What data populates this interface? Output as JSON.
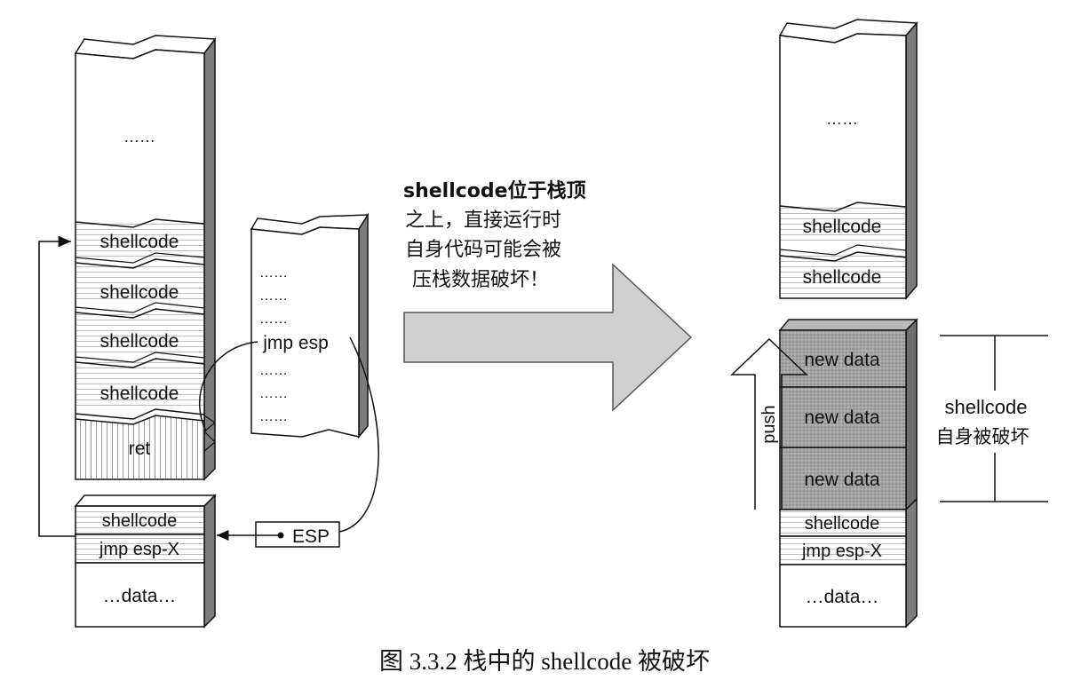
{
  "left_stack": {
    "top_dots": "……",
    "shellcode_blocks": [
      "shellcode",
      "shellcode",
      "shellcode",
      "shellcode"
    ],
    "ret_label": "ret",
    "lower_shellcode": "shellcode",
    "lower_jmp": "jmp esp-X",
    "lower_data": "…data…"
  },
  "code_panel": {
    "dots_1": "……",
    "dots_2": "……",
    "dots_3": "……",
    "jmp_label": "jmp esp",
    "dots_4": "……",
    "dots_5": "……",
    "dots_6": "……"
  },
  "esp_label": "ESP",
  "annotation": {
    "line1": "shellcode位于栈顶",
    "line2": "之上，直接运行时",
    "line3": "自身代码可能会被",
    "line4": "压栈数据破坏！"
  },
  "right_stack": {
    "top_dots": "……",
    "shellcode_blocks": [
      "shellcode",
      "shellcode"
    ],
    "new_data": [
      "new data",
      "new data",
      "new data"
    ],
    "push_label": "push",
    "lower_shellcode": "shellcode",
    "lower_jmp": "jmp esp-X",
    "lower_data": "…data…"
  },
  "brace_note": {
    "line1": "shellcode",
    "line2": "自身被破坏"
  },
  "caption": "图 3.3.2   栈中的 shellcode 被破坏"
}
